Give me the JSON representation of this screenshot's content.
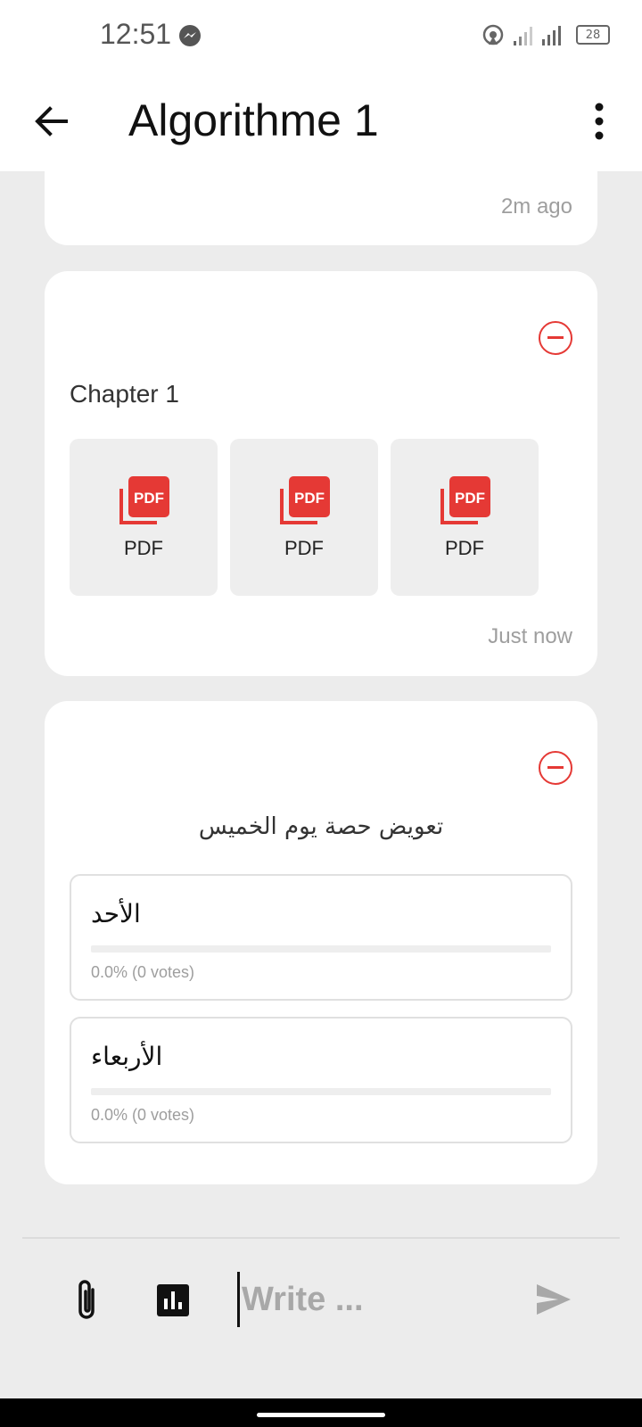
{
  "status_bar": {
    "time": "12:51",
    "battery": "28",
    "icons": [
      "messenger-icon",
      "hotspot-icon",
      "signal-icon",
      "battery-icon"
    ]
  },
  "app_bar": {
    "title": "Algorithme 1",
    "icons": [
      "back-arrow-icon",
      "more-vert-icon"
    ]
  },
  "feed": {
    "previous_post": {
      "timestamp": "2m ago"
    },
    "chapter_post": {
      "title": "Chapter 1",
      "files": [
        {
          "label": "PDF",
          "icon": "pdf-icon"
        },
        {
          "label": "PDF",
          "icon": "pdf-icon"
        },
        {
          "label": "PDF",
          "icon": "pdf-icon"
        }
      ],
      "timestamp": "Just now"
    },
    "poll_post": {
      "question": "تعويض حصة يوم الخميس",
      "options": [
        {
          "label": "الأحد",
          "stats": "0.0% (0 votes)",
          "percent": 0
        },
        {
          "label": "الأربعاء",
          "stats": "0.0% (0 votes)",
          "percent": 0
        }
      ]
    }
  },
  "composer": {
    "placeholder": "Write ...",
    "icons": [
      "paperclip-icon",
      "poll-chart-icon",
      "send-icon"
    ]
  },
  "colors": {
    "accent_red": "#e53935",
    "background": "#ececec",
    "card": "#ffffff"
  }
}
